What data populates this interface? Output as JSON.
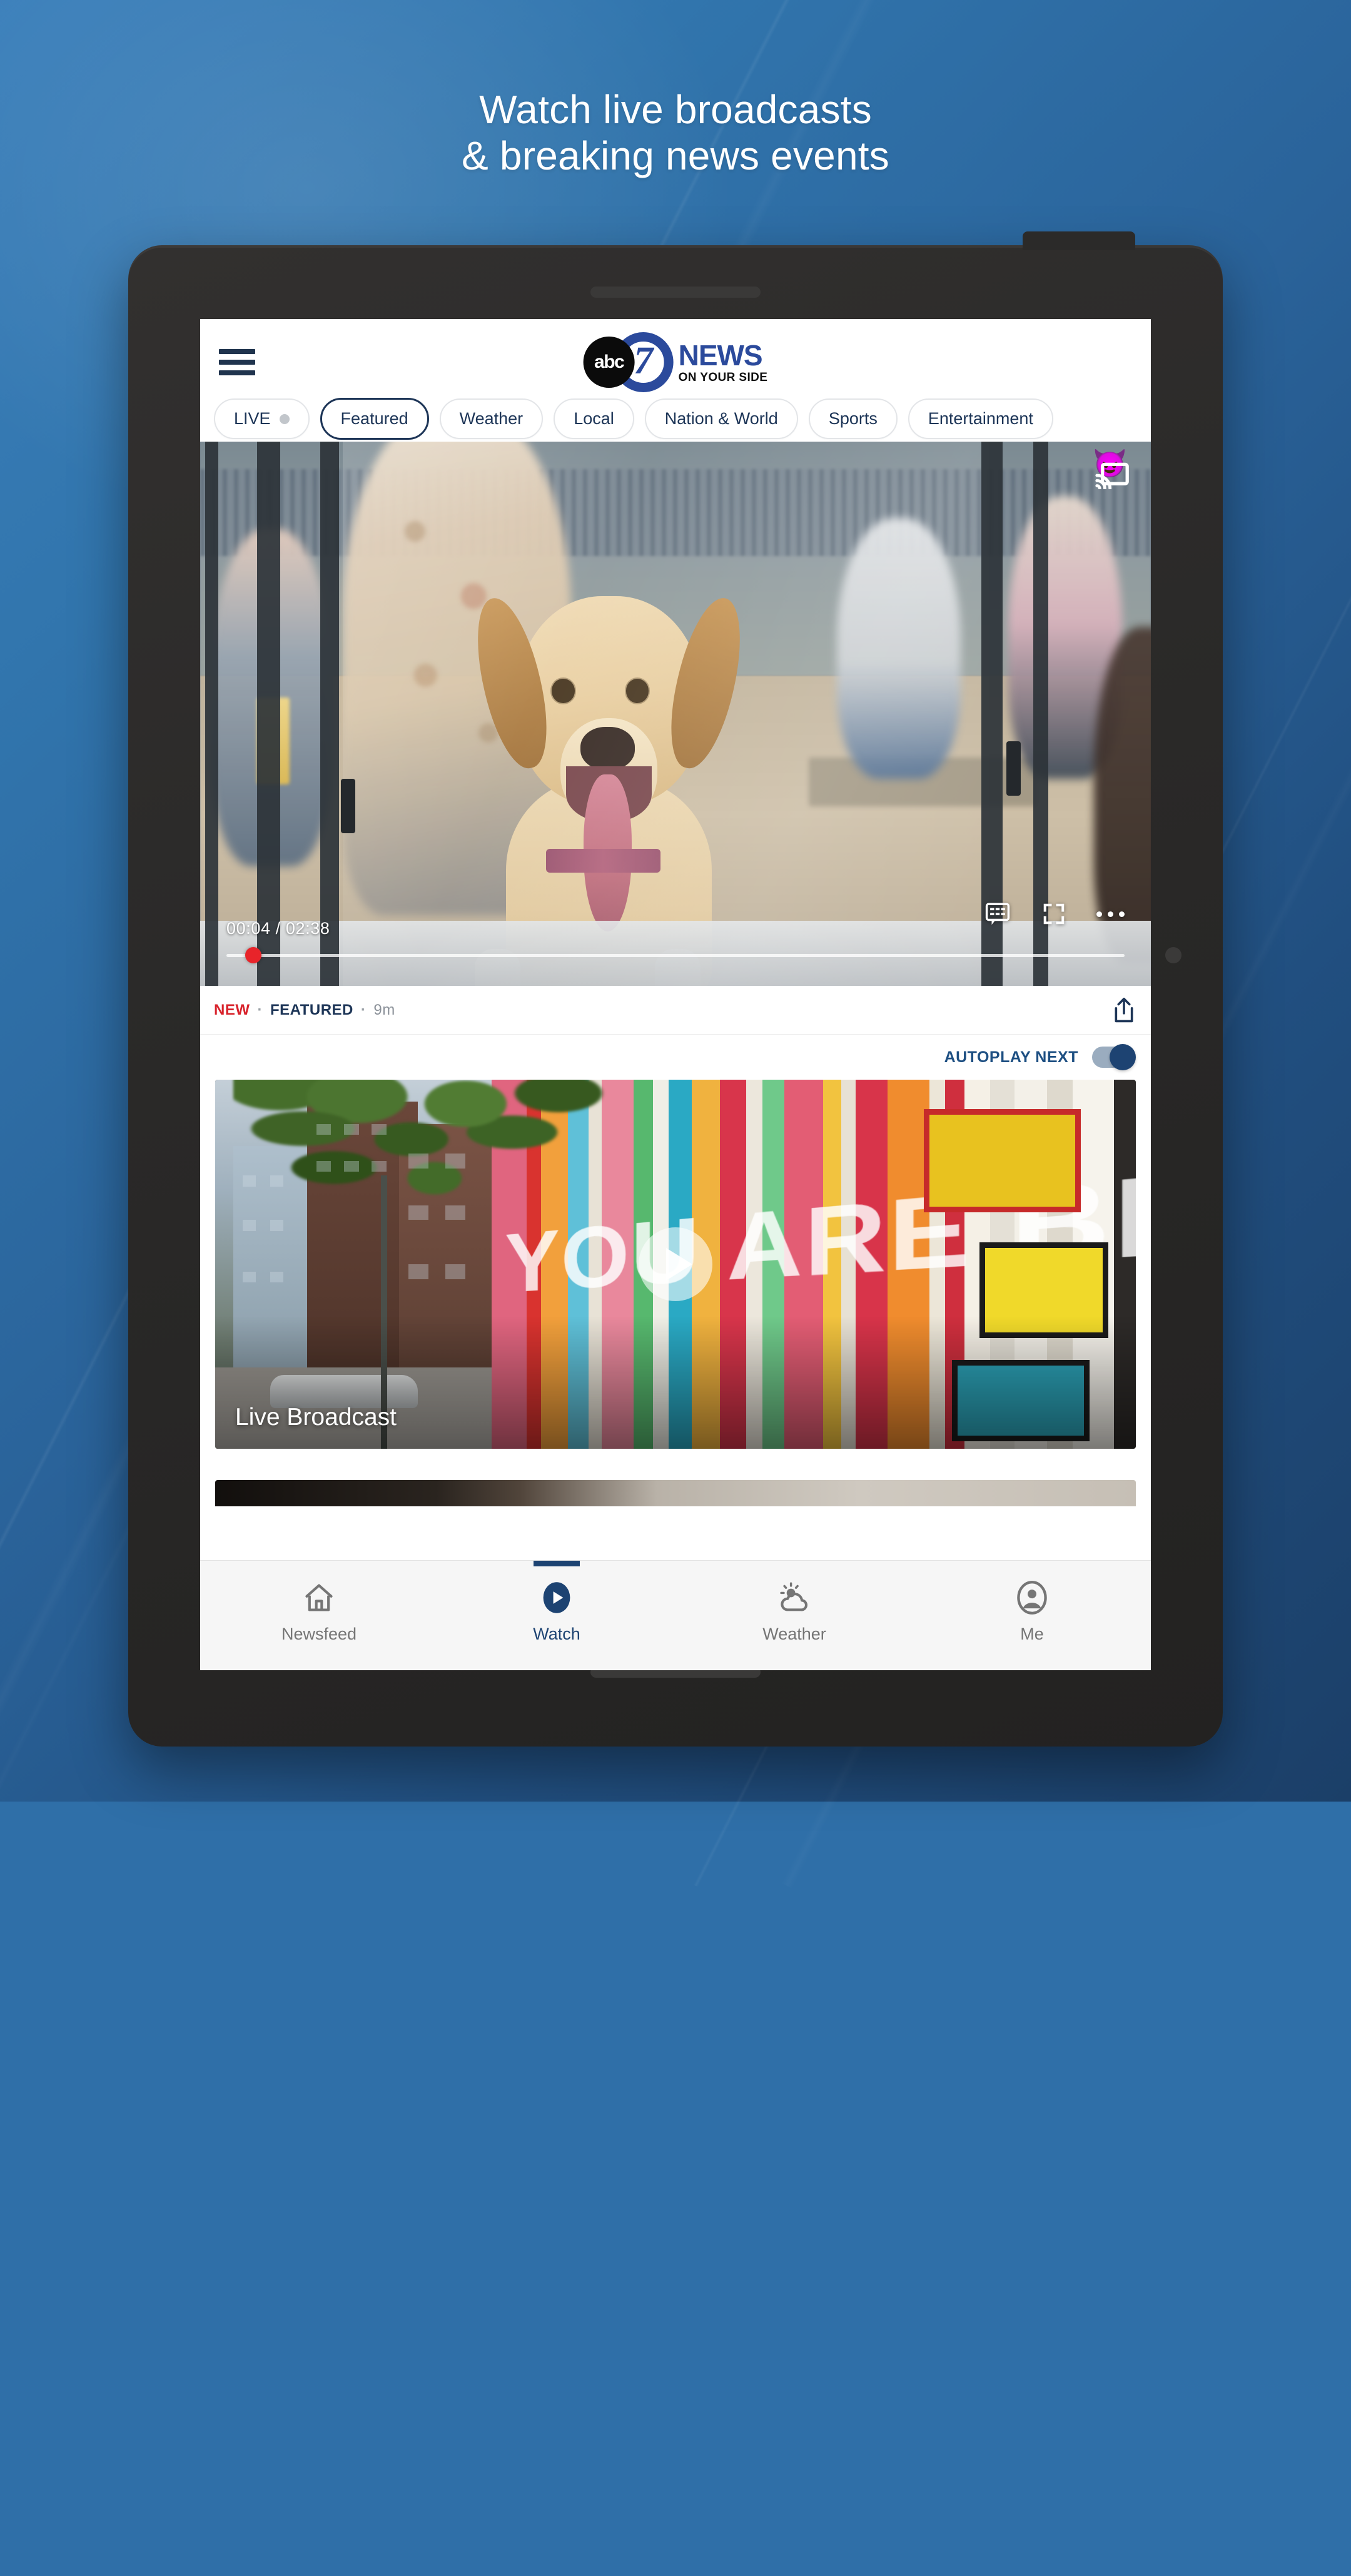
{
  "promo": {
    "headline_line1": "Watch live broadcasts",
    "headline_line2": "& breaking news events",
    "bg_color_top": "#3c80bb",
    "bg_color_bottom": "#1b3f68"
  },
  "app": {
    "brand": {
      "abc_mark": "abc",
      "seven": "7",
      "news": "NEWS",
      "tagline": "ON YOUR SIDE",
      "brand_color": "#2b4a9c"
    },
    "menu_icon": "hamburger-menu-icon",
    "nav_pills": [
      {
        "label": "LIVE",
        "selected": false,
        "has_dot": true
      },
      {
        "label": "Featured",
        "selected": true,
        "has_dot": false
      },
      {
        "label": "Weather",
        "selected": false,
        "has_dot": false
      },
      {
        "label": "Local",
        "selected": false,
        "has_dot": false
      },
      {
        "label": "Nation & World",
        "selected": false,
        "has_dot": false
      },
      {
        "label": "Sports",
        "selected": false,
        "has_dot": false
      },
      {
        "label": "Entertainment",
        "selected": false,
        "has_dot": false
      }
    ],
    "player": {
      "current_time": "00:04",
      "total_time": "02:38",
      "time_display": "00:04 / 02:38",
      "progress_percent": 3,
      "progress_color": "#e8242a",
      "cast_icon": "chromecast-icon",
      "captions_icon": "closed-captions-icon",
      "fullscreen_icon": "fullscreen-icon",
      "more_icon": "more-options-icon"
    },
    "meta": {
      "tag_new": "NEW",
      "separator": "·",
      "tag_category": "FEATURED",
      "time_ago": "9m",
      "share_icon": "share-icon",
      "new_color": "#d8222b",
      "category_color": "#1d3557"
    },
    "autoplay": {
      "label": "AUTOPLAY NEXT",
      "enabled": true,
      "accent_color": "#1d4372"
    },
    "mural_card": {
      "title": "Live Broadcast",
      "mural_text": "YOU ARE BEAUTIFUL",
      "play_icon": "play-button-icon"
    },
    "bottom_nav": [
      {
        "label": "Newsfeed",
        "icon": "home-icon",
        "active": false
      },
      {
        "label": "Watch",
        "icon": "play-circle-icon",
        "active": true
      },
      {
        "label": "Weather",
        "icon": "sun-cloud-icon",
        "active": false
      },
      {
        "label": "Me",
        "icon": "person-circle-icon",
        "active": false
      }
    ]
  }
}
